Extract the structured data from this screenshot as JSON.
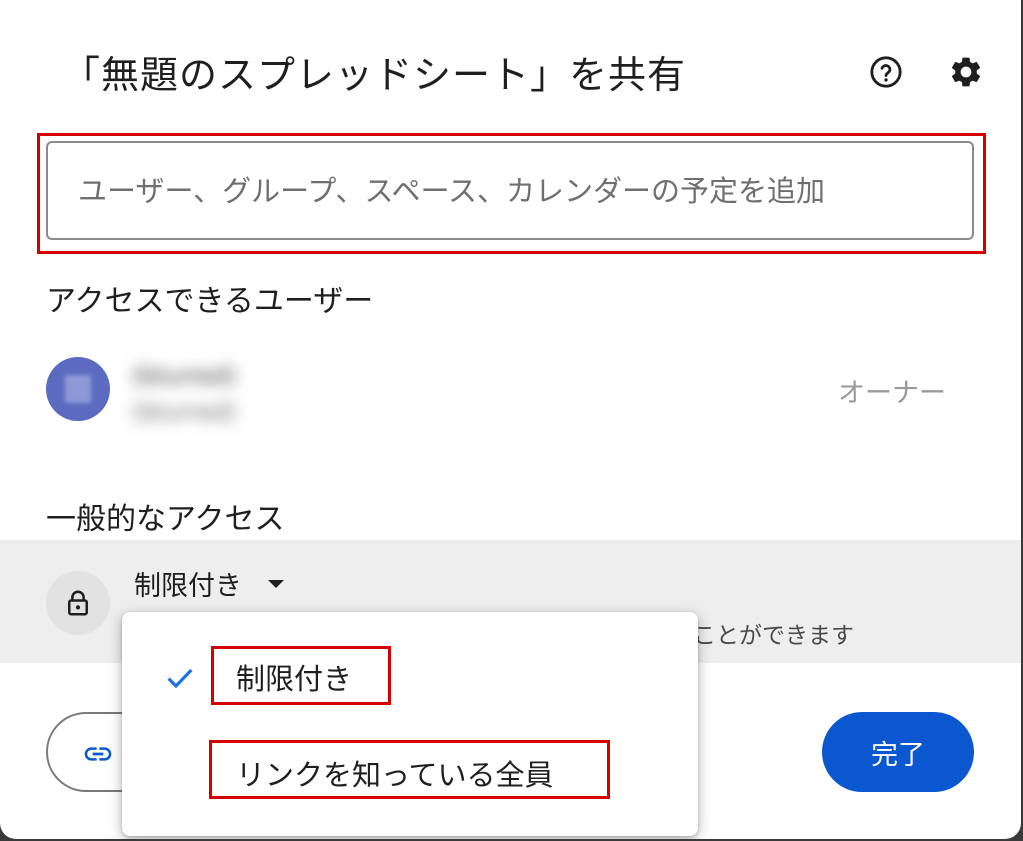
{
  "dialog": {
    "title": "「無題のスプレッドシート」を共有",
    "help_icon": "help-circle-icon",
    "settings_icon": "gear-icon"
  },
  "share_input": {
    "placeholder": "ユーザー、グループ、スペース、カレンダーの予定を追加",
    "value": ""
  },
  "people_section": {
    "heading": "アクセスできるユーザー",
    "users": [
      {
        "name": "(blurred)",
        "email": "(blurred)",
        "role": "オーナー"
      }
    ]
  },
  "general_access": {
    "heading": "一般的なアクセス",
    "selected": "制限付き",
    "description_visible": "ことができます",
    "lock_icon": "lock-icon"
  },
  "dropdown": {
    "options": [
      {
        "label": "制限付き",
        "checked": true
      },
      {
        "label": "リンクを知っている全員",
        "checked": false
      }
    ]
  },
  "footer": {
    "copy_link_icon": "link-icon",
    "done_label": "完了"
  },
  "colors": {
    "primary": "#0b57d0",
    "avatar": "#5c6bc0",
    "highlight": "#d50000",
    "check": "#1a73e8",
    "row_bg": "#eeeeee"
  }
}
